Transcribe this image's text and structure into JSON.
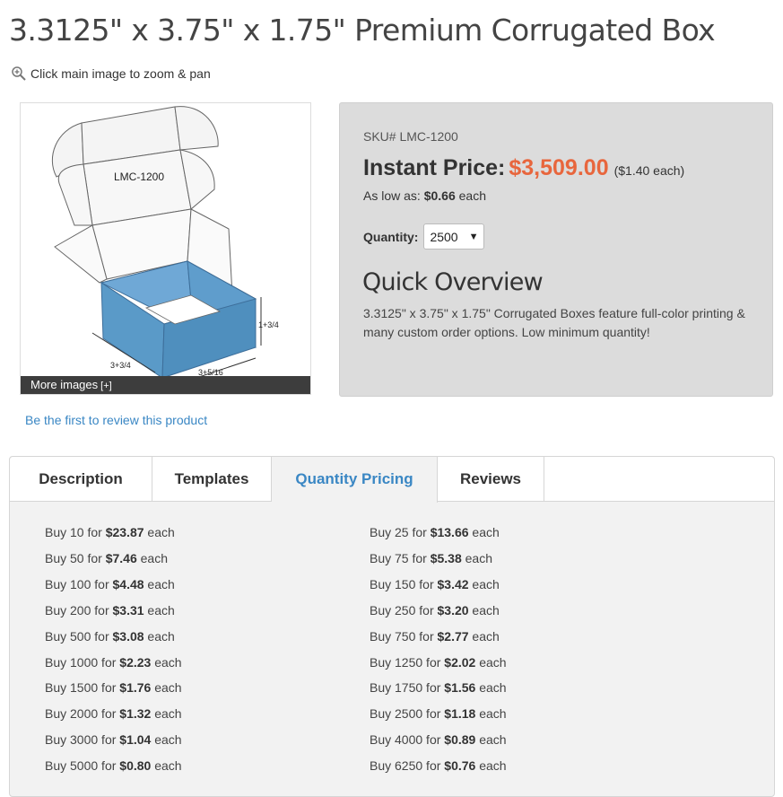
{
  "product": {
    "title": "3.3125\" x 3.75\" x 1.75\" Premium Corrugated Box",
    "zoom_hint": "Click main image to zoom & pan",
    "image_label": "LMC-1200",
    "dim_height": "1+3/4",
    "dim_width": "3+3/4",
    "dim_length": "3+5/16",
    "more_images": "More images",
    "more_images_plus": "[+]",
    "review_link": "Be the first to review this product"
  },
  "price_panel": {
    "sku": "SKU# LMC-1200",
    "price_label": "Instant Price:",
    "price_value": "$3,509.00",
    "price_each": "($1.40 each)",
    "low_prefix": "As low as:",
    "low_value": "$0.66",
    "low_suffix": "each",
    "quantity_label": "Quantity:",
    "quantity_value": "2500",
    "overview_title": "Quick Overview",
    "overview_text": "3.3125\" x 3.75\" x 1.75\" Corrugated Boxes feature full-color printing & many custom order options. Low minimum quantity!"
  },
  "tabs": [
    {
      "label": "Description"
    },
    {
      "label": "Templates"
    },
    {
      "label": "Quantity Pricing"
    },
    {
      "label": "Reviews"
    }
  ],
  "active_tab": "Quantity Pricing",
  "pricing": {
    "left": [
      {
        "prefix": "Buy 10 for",
        "price": "$23.87",
        "suffix": "each"
      },
      {
        "prefix": "Buy 50 for",
        "price": "$7.46",
        "suffix": "each"
      },
      {
        "prefix": "Buy 100 for",
        "price": "$4.48",
        "suffix": "each"
      },
      {
        "prefix": "Buy 200 for",
        "price": "$3.31",
        "suffix": "each"
      },
      {
        "prefix": "Buy 500 for",
        "price": "$3.08",
        "suffix": "each"
      },
      {
        "prefix": "Buy 1000 for",
        "price": "$2.23",
        "suffix": "each"
      },
      {
        "prefix": "Buy 1500 for",
        "price": "$1.76",
        "suffix": "each"
      },
      {
        "prefix": "Buy 2000 for",
        "price": "$1.32",
        "suffix": "each"
      },
      {
        "prefix": "Buy 3000 for",
        "price": "$1.04",
        "suffix": "each"
      },
      {
        "prefix": "Buy 5000 for",
        "price": "$0.80",
        "suffix": "each"
      }
    ],
    "right": [
      {
        "prefix": "Buy 25 for",
        "price": "$13.66",
        "suffix": "each"
      },
      {
        "prefix": "Buy 75 for",
        "price": "$5.38",
        "suffix": "each"
      },
      {
        "prefix": "Buy 150 for",
        "price": "$3.42",
        "suffix": "each"
      },
      {
        "prefix": "Buy 250 for",
        "price": "$3.20",
        "suffix": "each"
      },
      {
        "prefix": "Buy 750 for",
        "price": "$2.77",
        "suffix": "each"
      },
      {
        "prefix": "Buy 1250 for",
        "price": "$2.02",
        "suffix": "each"
      },
      {
        "prefix": "Buy 1750 for",
        "price": "$1.56",
        "suffix": "each"
      },
      {
        "prefix": "Buy 2500 for",
        "price": "$1.18",
        "suffix": "each"
      },
      {
        "prefix": "Buy 4000 for",
        "price": "$0.89",
        "suffix": "each"
      },
      {
        "prefix": "Buy 6250 for",
        "price": "$0.76",
        "suffix": "each"
      }
    ]
  },
  "colors": {
    "accent": "#e8663d",
    "link": "#3a87c4",
    "box_blue": "#5a9ac8"
  }
}
